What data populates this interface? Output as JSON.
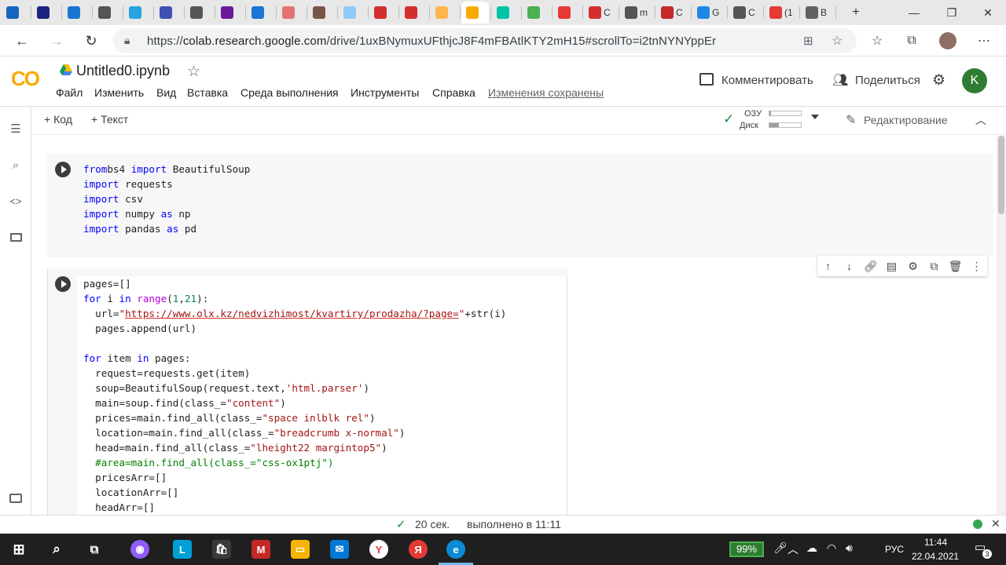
{
  "browser": {
    "tabs": [
      {
        "label": "",
        "icon": "acmp-icon"
      },
      {
        "label": "",
        "icon": "shield-icon"
      },
      {
        "label": "",
        "icon": "docs-icon"
      },
      {
        "label": "",
        "icon": "file-icon"
      },
      {
        "label": "",
        "icon": "telegram-icon"
      },
      {
        "label": "",
        "icon": "share-icon"
      },
      {
        "label": "",
        "icon": "file-icon"
      },
      {
        "label": "",
        "icon": "p-icon"
      },
      {
        "label": "",
        "icon": "docs-icon"
      },
      {
        "label": "",
        "icon": "pdf-icon"
      },
      {
        "label": "",
        "icon": "person-icon"
      },
      {
        "label": "",
        "icon": "globe-icon"
      },
      {
        "label": "",
        "icon": "pdf-icon"
      },
      {
        "label": "",
        "icon": "pdf-icon"
      },
      {
        "label": "",
        "icon": "circle-icon"
      },
      {
        "label": "",
        "icon": "colab-icon"
      },
      {
        "label": "",
        "icon": "olx-icon"
      },
      {
        "label": "",
        "icon": "drive-icon"
      },
      {
        "label": "",
        "icon": "news-icon"
      },
      {
        "label": "C",
        "icon": "record-icon"
      },
      {
        "label": "m",
        "icon": "file-icon"
      },
      {
        "label": "C",
        "icon": "h-icon"
      },
      {
        "label": "G",
        "icon": "translate-icon"
      },
      {
        "label": "C",
        "icon": "ai-icon"
      },
      {
        "label": "(1",
        "icon": "youtube-icon"
      },
      {
        "label": "B",
        "icon": "bank-icon"
      }
    ],
    "new_tab": "+",
    "url": "https://colab.research.google.com/drive/1uxBNymuxUFthjcJ8F4mFBAtlKTY2mH15#scrollTo=i2tnNYNYppEr",
    "url_host": "colab.research.google.com",
    "url_prefix": "https://",
    "url_path": "/drive/1uxBNymuxUFthjcJ8F4mFBAtlKTY2mH15#scrollTo=i2tnNYNYppEr"
  },
  "colab": {
    "logo": "CO",
    "notebook_title": "Untitled0.ipynb",
    "menu": [
      "Файл",
      "Изменить",
      "Вид",
      "Вставка",
      "Среда выполнения",
      "Инструменты",
      "Справка"
    ],
    "saved_status": "Изменения сохранены",
    "comment_label": "Комментировать",
    "share_label": "Поделиться",
    "avatar_letter": "K",
    "add_code": "Код",
    "add_text": "Текст",
    "ram_label": "ОЗУ",
    "disk_label": "Диск",
    "ram_fraction": 0.05,
    "disk_fraction": 0.3,
    "edit_mode": "Редактирование"
  },
  "cells": {
    "cell1_lines": [
      [
        [
          "kw",
          "from"
        ],
        [
          "",
          "bs4 "
        ],
        [
          "kw",
          "import"
        ],
        [
          "",
          " BeautifulSoup"
        ]
      ],
      [
        [
          "kw",
          "import"
        ],
        [
          "",
          " requests"
        ]
      ],
      [
        [
          "kw",
          "import"
        ],
        [
          "",
          " csv"
        ]
      ],
      [
        [
          "kw",
          "import"
        ],
        [
          "",
          " numpy "
        ],
        [
          "kw",
          "as"
        ],
        [
          "",
          " np"
        ]
      ],
      [
        [
          "kw",
          "import"
        ],
        [
          "",
          " pandas "
        ],
        [
          "kw",
          "as"
        ],
        [
          "",
          " pd"
        ]
      ]
    ],
    "cell2_lines": [
      [
        [
          "",
          "pages=[]"
        ]
      ],
      [
        [
          "kw",
          "for"
        ],
        [
          "",
          " i "
        ],
        [
          "kw",
          "in"
        ],
        [
          "",
          " "
        ],
        [
          "kw2",
          "range"
        ],
        [
          "",
          "("
        ],
        [
          "num",
          "1"
        ],
        [
          "",
          ","
        ],
        [
          "num",
          "21"
        ],
        [
          "",
          "):"
        ]
      ],
      [
        [
          "",
          "  url="
        ],
        [
          "str",
          "\""
        ],
        [
          "link",
          "https://www.olx.kz/nedvizhimost/kvartiry/prodazha/?page="
        ],
        [
          "str",
          "\""
        ],
        [
          "",
          "+str(i)"
        ]
      ],
      [
        [
          "",
          "  pages.append(url)"
        ]
      ],
      [
        [
          "",
          ""
        ]
      ],
      [
        [
          "kw",
          "for"
        ],
        [
          "",
          " item "
        ],
        [
          "kw",
          "in"
        ],
        [
          "",
          " pages:"
        ]
      ],
      [
        [
          "",
          "  request=requests.get(item)"
        ]
      ],
      [
        [
          "",
          "  soup=BeautifulSoup(request.text,"
        ],
        [
          "str",
          "'html.parser'"
        ],
        [
          "",
          ")"
        ]
      ],
      [
        [
          "",
          "  main=soup.find(class_="
        ],
        [
          "str",
          "\"content\""
        ],
        [
          "",
          ")"
        ]
      ],
      [
        [
          "",
          "  prices=main.find_all(class_="
        ],
        [
          "str",
          "\"space inlblk rel\""
        ],
        [
          "",
          ")"
        ]
      ],
      [
        [
          "",
          "  location=main.find_all(class_="
        ],
        [
          "str",
          "\"breadcrumb x-normal\""
        ],
        [
          "",
          ")"
        ]
      ],
      [
        [
          "",
          "  head=main.find_all(class_="
        ],
        [
          "str",
          "\"lheight22 margintop5\""
        ],
        [
          "",
          ")"
        ]
      ],
      [
        [
          "cmt",
          "  #area=main.find_all(class_=\"css-ox1ptj\")"
        ]
      ],
      [
        [
          "",
          "  pricesArr=[]"
        ]
      ],
      [
        [
          "",
          "  locationArr=[]"
        ]
      ],
      [
        [
          "",
          "  headArr=[]"
        ]
      ]
    ]
  },
  "status": {
    "elapsed": "20 сек.",
    "completed": "выполнено в 11:11"
  },
  "taskbar": {
    "battery": "99%",
    "lang": "РУС",
    "time": "11:44",
    "date": "22.04.2021",
    "notifications": "3"
  }
}
